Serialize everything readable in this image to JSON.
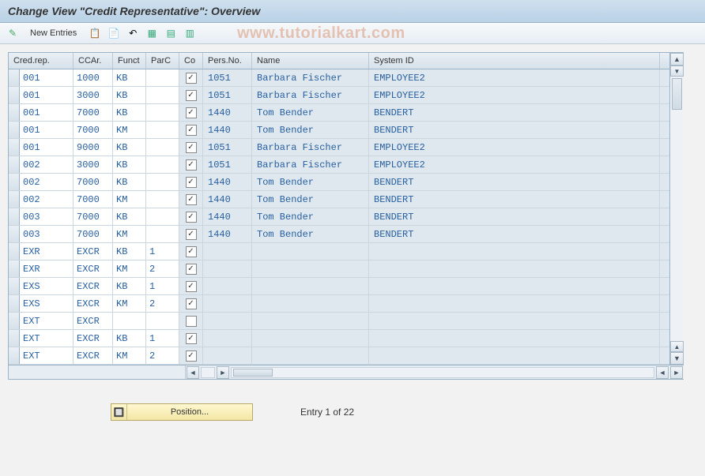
{
  "title": "Change View \"Credit Representative\": Overview",
  "watermark": "www.tutorialkart.com",
  "toolbar": {
    "new_entries_label": "New Entries",
    "icons": [
      "wand-icon",
      "copy-icon",
      "doc-new-icon",
      "undo-icon",
      "select-all-icon",
      "select-block-icon",
      "deselect-icon"
    ]
  },
  "columns": {
    "credrep": "Cred.rep.",
    "ccar": "CCAr.",
    "funct": "Funct",
    "parc": "ParC",
    "co": "Co",
    "persno": "Pers.No.",
    "name": "Name",
    "sysid": "System ID"
  },
  "rows": [
    {
      "credrep": "001",
      "ccar": "1000",
      "funct": "KB",
      "parc": "",
      "co": true,
      "persno": "1051",
      "name": "Barbara Fischer",
      "sysid": "EMPLOYEE2"
    },
    {
      "credrep": "001",
      "ccar": "3000",
      "funct": "KB",
      "parc": "",
      "co": true,
      "persno": "1051",
      "name": "Barbara Fischer",
      "sysid": "EMPLOYEE2"
    },
    {
      "credrep": "001",
      "ccar": "7000",
      "funct": "KB",
      "parc": "",
      "co": true,
      "persno": "1440",
      "name": "Tom Bender",
      "sysid": "BENDERT"
    },
    {
      "credrep": "001",
      "ccar": "7000",
      "funct": "KM",
      "parc": "",
      "co": true,
      "persno": "1440",
      "name": "Tom Bender",
      "sysid": "BENDERT"
    },
    {
      "credrep": "001",
      "ccar": "9000",
      "funct": "KB",
      "parc": "",
      "co": true,
      "persno": "1051",
      "name": "Barbara Fischer",
      "sysid": "EMPLOYEE2"
    },
    {
      "credrep": "002",
      "ccar": "3000",
      "funct": "KB",
      "parc": "",
      "co": true,
      "persno": "1051",
      "name": "Barbara Fischer",
      "sysid": "EMPLOYEE2"
    },
    {
      "credrep": "002",
      "ccar": "7000",
      "funct": "KB",
      "parc": "",
      "co": true,
      "persno": "1440",
      "name": "Tom Bender",
      "sysid": "BENDERT"
    },
    {
      "credrep": "002",
      "ccar": "7000",
      "funct": "KM",
      "parc": "",
      "co": true,
      "persno": "1440",
      "name": "Tom Bender",
      "sysid": "BENDERT"
    },
    {
      "credrep": "003",
      "ccar": "7000",
      "funct": "KB",
      "parc": "",
      "co": true,
      "persno": "1440",
      "name": "Tom Bender",
      "sysid": "BENDERT"
    },
    {
      "credrep": "003",
      "ccar": "7000",
      "funct": "KM",
      "parc": "",
      "co": true,
      "persno": "1440",
      "name": "Tom Bender",
      "sysid": "BENDERT"
    },
    {
      "credrep": "EXR",
      "ccar": "EXCR",
      "funct": "KB",
      "parc": "1",
      "co": true,
      "persno": "",
      "name": "",
      "sysid": ""
    },
    {
      "credrep": "EXR",
      "ccar": "EXCR",
      "funct": "KM",
      "parc": "2",
      "co": true,
      "persno": "",
      "name": "",
      "sysid": ""
    },
    {
      "credrep": "EXS",
      "ccar": "EXCR",
      "funct": "KB",
      "parc": "1",
      "co": true,
      "persno": "",
      "name": "",
      "sysid": ""
    },
    {
      "credrep": "EXS",
      "ccar": "EXCR",
      "funct": "KM",
      "parc": "2",
      "co": true,
      "persno": "",
      "name": "",
      "sysid": ""
    },
    {
      "credrep": "EXT",
      "ccar": "EXCR",
      "funct": "",
      "parc": "",
      "co": false,
      "persno": "",
      "name": "",
      "sysid": ""
    },
    {
      "credrep": "EXT",
      "ccar": "EXCR",
      "funct": "KB",
      "parc": "1",
      "co": true,
      "persno": "",
      "name": "",
      "sysid": ""
    },
    {
      "credrep": "EXT",
      "ccar": "EXCR",
      "funct": "KM",
      "parc": "2",
      "co": true,
      "persno": "",
      "name": "",
      "sysid": ""
    }
  ],
  "footer": {
    "position_label": "Position...",
    "entry_text": "Entry 1 of 22"
  }
}
